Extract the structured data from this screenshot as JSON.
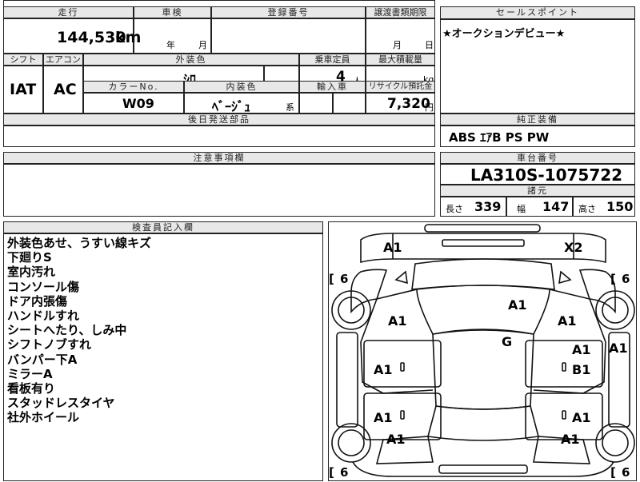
{
  "top_left": {
    "mileage_label": "走行",
    "mileage_value": "144,530",
    "mileage_unit": "km",
    "inspection_label": "車検",
    "year_label": "年",
    "month_label": "月",
    "registration_label": "登録番号",
    "transfer_doc_label": "譲渡書類期限",
    "transfer_month": "月",
    "transfer_day": "日",
    "shift_label": "シフト",
    "shift_value": "IAT",
    "aircon_label": "エアコン",
    "aircon_value": "AC",
    "exterior_color_label": "外装色",
    "exterior_color_value": "ｼﾛ",
    "capacity_label": "乗車定員",
    "capacity_value": "4",
    "capacity_unit": "人",
    "load_label": "最大積載量",
    "load_unit": "kg",
    "color_no_label": "カラーNo.",
    "color_no_value": "W09",
    "interior_color_label": "内装色",
    "interior_color_value": "ﾍﾞｰｼﾞｭ",
    "interior_color_suffix": "系",
    "import_label": "輸入車",
    "recycle_label": "リサイクル預託金",
    "recycle_value": "7,320",
    "recycle_unit": "円",
    "later_parts_label": "後日発送部品"
  },
  "sales_point": {
    "label": "セールスポイント",
    "text": "★オークションデビュー★"
  },
  "genuine_equipment": {
    "label": "純正装備",
    "text": "ABS ｴｱB PS PW"
  },
  "caution": {
    "label": "注意事項欄"
  },
  "chassis": {
    "label": "車台番号",
    "value": "LA310S-1075722",
    "specs_label": "諸元",
    "length_label": "長さ",
    "length_value": "339",
    "width_label": "幅",
    "width_value": "147",
    "height_label": "高さ",
    "height_value": "150"
  },
  "inspector": {
    "label": "検査員記入欄",
    "notes": [
      "外装色あせ、うすい線キズ",
      "下廻りS",
      "室内汚れ",
      "コンソール傷",
      "ドア内張傷",
      "ハンドルすれ",
      "シートへたり、しみ中",
      "シフトノブすれ",
      "バンパー下A",
      "ミラーA",
      "看板有り",
      "スタッドレスタイヤ",
      "社外ホイール"
    ]
  },
  "diagram": {
    "marks": {
      "front_left": "A1",
      "front_right": "X2",
      "hood": "A1",
      "left_fender": "A1",
      "right_fender": "A1",
      "roof": "G",
      "left_door_front": "A1",
      "right_door_front": "A1",
      "right_body_side": "A1",
      "right_door_rear_upper": "B1",
      "left_door_rear": "A1",
      "right_door_rear": "A1",
      "left_rear_quarter": "A1",
      "right_rear_quarter": "A1"
    },
    "tire_labels": {
      "front_left": "6",
      "front_right": "6",
      "rear_left": "6",
      "rear_right": "6"
    }
  }
}
